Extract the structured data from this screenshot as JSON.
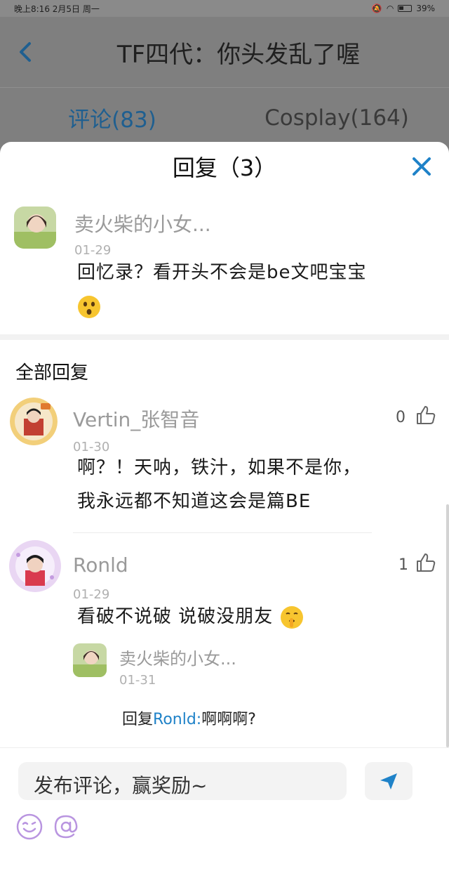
{
  "status_bar": {
    "time_date": "晚上8:16 2月5日 周一",
    "battery": "39%"
  },
  "page": {
    "title": "TF四代：你头发乱了喔",
    "tabs": [
      {
        "label": "评论(83)",
        "active": true
      },
      {
        "label": "Cosplay(164)",
        "active": false
      }
    ]
  },
  "sheet": {
    "title": "回复（3）",
    "root_comment": {
      "username": "卖火柴的小女...",
      "date": "01-29",
      "text": "回忆录？看开头不会是be文吧宝宝",
      "emoji": "astonished-emoji"
    },
    "section_title": "全部回复",
    "replies": [
      {
        "username": "Vertin_张智音",
        "date": "01-30",
        "likes": "0",
        "text_line1": "啊？！天呐，铁汁，如果不是你，",
        "text_line2": "我永远都不知道这会是篇BE"
      },
      {
        "username": "Ronld",
        "date": "01-29",
        "likes": "1",
        "text": "看破不说破 说破没朋友",
        "emoji": "shushing-face-emoji",
        "sub_reply": {
          "username": "卖火柴的小女...",
          "date": "01-31",
          "prefix": "回复",
          "mention": "Ronld:",
          "text": "啊啊啊?"
        }
      }
    ]
  },
  "composer": {
    "placeholder": "发布评论，赢奖励~"
  },
  "colors": {
    "accent": "#1f82c8",
    "sheet_bg": "#ffffff",
    "dim_overlay": "#7f7f7f"
  }
}
